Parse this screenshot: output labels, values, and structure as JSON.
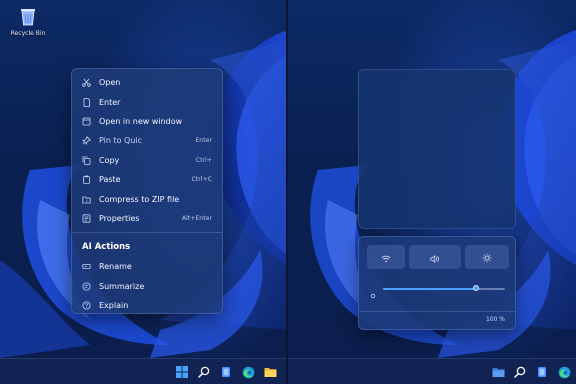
{
  "desktop": {
    "recycle_bin_label": "Recycle Bin"
  },
  "context_menu": {
    "items": [
      {
        "label": "Open",
        "shortcut": "",
        "icon": "scissors-icon"
      },
      {
        "label": "Enter",
        "shortcut": "",
        "icon": "document-icon"
      },
      {
        "label": "Open in new window",
        "shortcut": "",
        "icon": "window-icon"
      },
      {
        "label": "Pin to Quic",
        "shortcut": "Enter",
        "icon": "pin-icon"
      },
      {
        "label": "Copy",
        "shortcut": "Ctrl+",
        "icon": "copy-icon"
      },
      {
        "label": "Paste",
        "shortcut": "Ctrl+C",
        "icon": "clipboard-icon"
      },
      {
        "label": "Compress to ZIP file",
        "shortcut": "",
        "icon": "zip-folder-icon"
      },
      {
        "label": "Properties",
        "shortcut": "Alt+Enter",
        "icon": "properties-icon"
      }
    ],
    "ai_section_title": "AI Actions",
    "ai_items": [
      {
        "label": "Rename",
        "icon": "rename-icon"
      },
      {
        "label": "Summarize",
        "icon": "summarize-icon"
      },
      {
        "label": "Explain",
        "icon": "help-circle-icon"
      }
    ]
  },
  "quick_settings": {
    "buttons": [
      "wifi-icon",
      "volume-icon",
      "brightness-icon"
    ],
    "brightness_level": 0.76,
    "footer_value": "100 %"
  },
  "taskbar_left": {
    "icons": [
      "start-icon",
      "search-icon",
      "task-view-icon",
      "edge-icon",
      "file-explorer-icon"
    ]
  },
  "taskbar_right": {
    "icons": [
      "file-explorer-icon",
      "search-icon",
      "task-view-icon",
      "edge-icon"
    ]
  },
  "colors": {
    "accent": "#4a9fff",
    "menu_bg": "#1e3a78",
    "wallpaper_dark": "#0a2050"
  }
}
